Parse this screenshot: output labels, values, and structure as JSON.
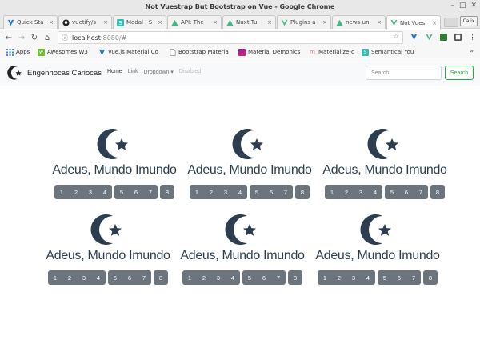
{
  "window": {
    "title": "Not Vuestrap But Bootstrap on Vue - Google Chrome"
  },
  "tabs": [
    {
      "label": "Quick Sta",
      "icon": "vuetify-icon",
      "color": "#1976d2"
    },
    {
      "label": "vuetify/s",
      "icon": "github-icon",
      "color": "#222222"
    },
    {
      "label": "Modal | S",
      "icon": "semantic-icon",
      "color": "#35bdb2"
    },
    {
      "label": "API: The",
      "icon": "nuxt-icon",
      "color": "#41b883"
    },
    {
      "label": "Nuxt Tu",
      "icon": "nuxt-icon",
      "color": "#41b883"
    },
    {
      "label": "Plugins a",
      "icon": "vue-icon",
      "color": "#41b883"
    },
    {
      "label": "news-un",
      "icon": "nuxt-icon",
      "color": "#41b883"
    },
    {
      "label": "Not Vues",
      "icon": "vue-icon",
      "color": "#41b883"
    }
  ],
  "profile": {
    "label": "Calix"
  },
  "address": {
    "host": "localhost",
    "rest": ":8080/#"
  },
  "bookmarks": [
    {
      "label": "Apps",
      "icon": "apps-grid-icon",
      "color": "#4285f4"
    },
    {
      "label": "Awesomes W3",
      "icon": "w3-icon",
      "color": "#6dbb2f"
    },
    {
      "label": "Vue.js Material Co",
      "icon": "vuetify-icon",
      "color": "#1976d2"
    },
    {
      "label": "Bootstrap Materia",
      "icon": "document-icon",
      "color": "#777777"
    },
    {
      "label": "Material Demonics",
      "icon": "demonics-icon",
      "color": "#8e24aa"
    },
    {
      "label": "Materialize-o",
      "icon": "materialize-icon",
      "color": "#ee6e73"
    },
    {
      "label": "Semantical You",
      "icon": "semantic-icon",
      "color": "#35bdb2"
    }
  ],
  "navbar": {
    "brand": "Engenhocas Cariocas",
    "links": {
      "home": "Home",
      "link": "Link",
      "dropdown": "Dropdown",
      "disabled": "Disabled"
    },
    "search_placeholder": "Search",
    "search_button": "Search"
  },
  "cards": [
    {
      "heading": "Adeus, Mundo Imundo",
      "groups": [
        [
          "1",
          "2",
          "3",
          "4"
        ],
        [
          "5",
          "6",
          "7"
        ],
        [
          "8"
        ]
      ]
    },
    {
      "heading": "Adeus, Mundo Imundo",
      "groups": [
        [
          "1",
          "2",
          "3",
          "4"
        ],
        [
          "5",
          "6",
          "7"
        ],
        [
          "8"
        ]
      ]
    },
    {
      "heading": "Adeus, Mundo Imundo",
      "groups": [
        [
          "1",
          "2",
          "3",
          "4"
        ],
        [
          "5",
          "6",
          "7"
        ],
        [
          "8"
        ]
      ]
    },
    {
      "heading": "Adeus, Mundo Imundo",
      "groups": [
        [
          "1",
          "2",
          "3",
          "4"
        ],
        [
          "5",
          "6",
          "7"
        ],
        [
          "8"
        ]
      ]
    },
    {
      "heading": "Adeus, Mundo Imundo",
      "groups": [
        [
          "1",
          "2",
          "3",
          "4"
        ],
        [
          "5",
          "6",
          "7"
        ],
        [
          "8"
        ]
      ]
    },
    {
      "heading": "Adeus, Mundo Imundo",
      "groups": [
        [
          "1",
          "2",
          "3",
          "4"
        ],
        [
          "5",
          "6",
          "7"
        ],
        [
          "8"
        ]
      ]
    }
  ],
  "colors": {
    "logo": "#2c3e50",
    "button": "#6c757d",
    "success": "#28a745"
  }
}
